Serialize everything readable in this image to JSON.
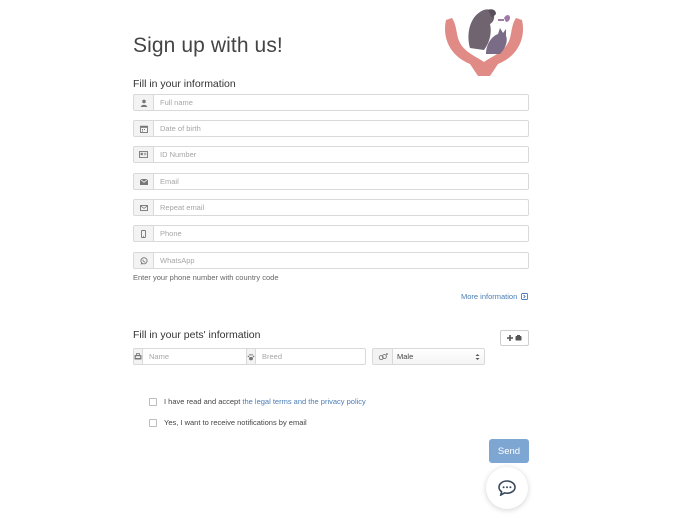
{
  "header": {
    "title": "Sign up with us!"
  },
  "owner_section": {
    "heading": "Fill in your information",
    "fields": [
      {
        "icon": "user-icon",
        "placeholder": "Full name"
      },
      {
        "icon": "calendar-icon",
        "placeholder": "Date of birth"
      },
      {
        "icon": "id-card-icon",
        "placeholder": "ID Number"
      },
      {
        "icon": "envelope-icon",
        "placeholder": "Email"
      },
      {
        "icon": "envelope-outline-icon",
        "placeholder": "Repeat email"
      },
      {
        "icon": "mobile-phone-icon",
        "placeholder": "Phone"
      },
      {
        "icon": "whatsapp-icon",
        "placeholder": "WhatsApp"
      }
    ],
    "help_text": "Enter your phone number with country code",
    "more_info_label": "More information"
  },
  "pets_section": {
    "heading": "Fill in your pets' information",
    "name_placeholder": "Name",
    "breed_placeholder": "Breed",
    "sex_selected": "Male",
    "add_pet_icon": "plus-pet-icon"
  },
  "consent": {
    "terms_prefix": "I have read and accept ",
    "terms_link": "the legal terms and the privacy policy",
    "notifications": "Yes, I want to receive notifications by email"
  },
  "actions": {
    "send_label": "Send",
    "chat_icon": "chat-icon"
  },
  "colors": {
    "accent": "#7ea6d3",
    "link": "#4a7db5",
    "logo_hands": "#e08b86",
    "logo_pets": "#6f6470"
  }
}
